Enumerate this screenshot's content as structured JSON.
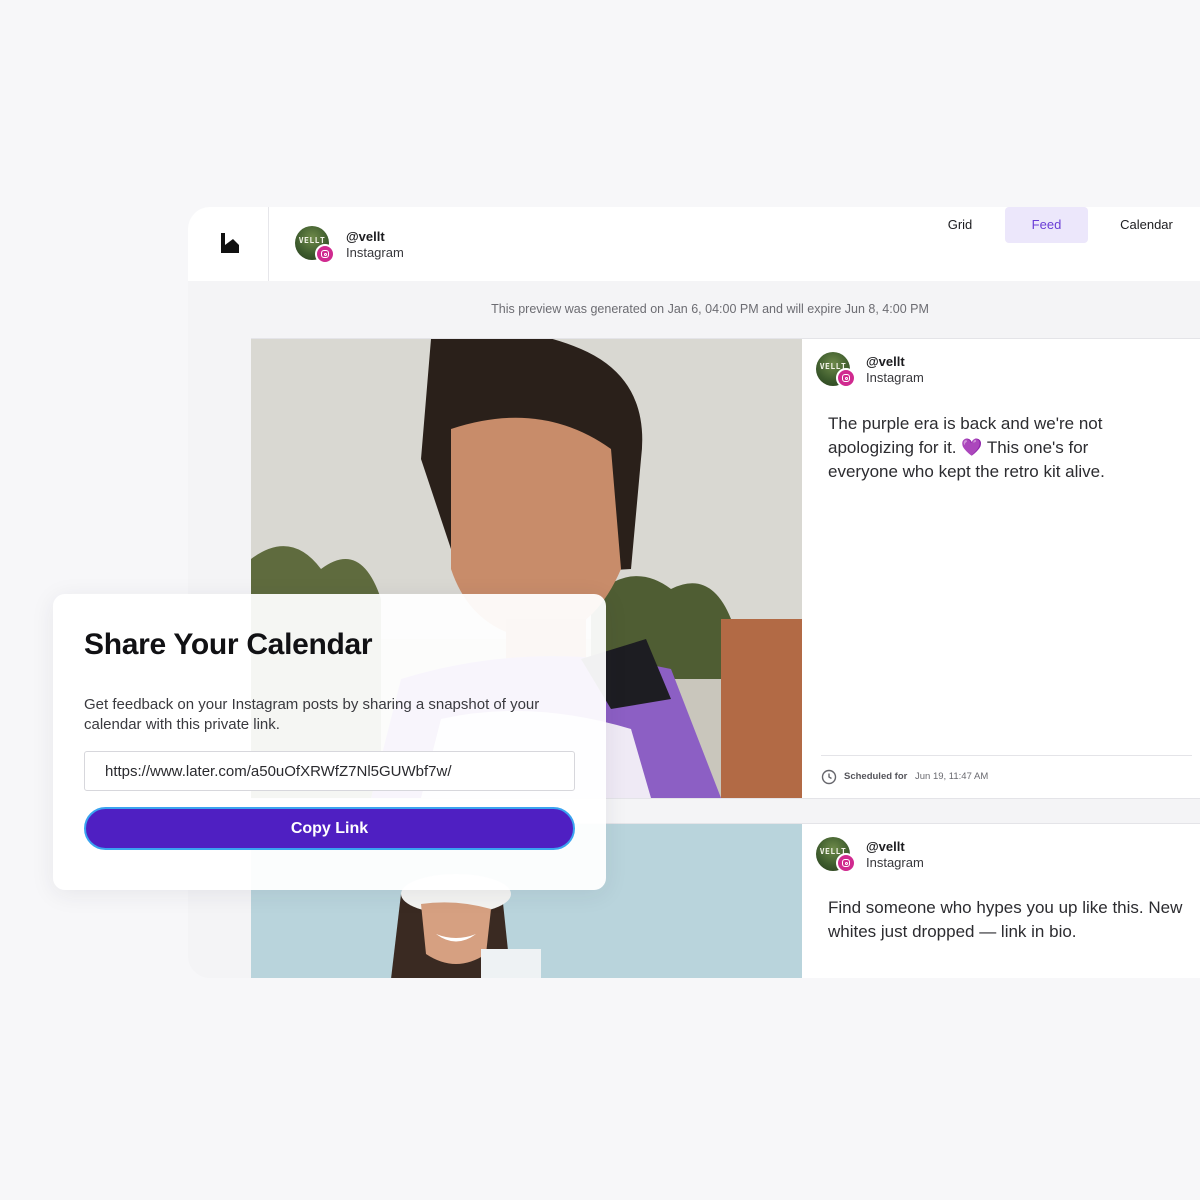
{
  "account": {
    "handle": "@vellt",
    "network": "Instagram",
    "avatar_text": "VELLT"
  },
  "tabs": [
    {
      "label": "Grid",
      "active": false
    },
    {
      "label": "Feed",
      "active": true
    },
    {
      "label": "Calendar",
      "active": false
    }
  ],
  "notice": "This preview was generated on Jan 6, 04:00 PM and will expire Jun 8, 4:00 PM",
  "posts": [
    {
      "handle": "@vellt",
      "network": "Instagram",
      "caption": "The purple era is back and we're not apologizing for it. 💜 This one's for everyone who kept the retro kit alive.",
      "scheduled_label": "Scheduled for",
      "scheduled_time": "Jun 19, 11:47 AM"
    },
    {
      "handle": "@vellt",
      "network": "Instagram",
      "caption": "Find someone who hypes you up like this. New whites just dropped — link in bio."
    }
  ],
  "share": {
    "title": "Share Your Calendar",
    "description": "Get feedback on your Instagram posts by sharing a snapshot of your calendar with this private link.",
    "link": "https://www.later.com/a50uOfXRWfZ7Nl5GUWbf7w/",
    "button": "Copy Link"
  },
  "colors": {
    "accent": "#4f1fc2",
    "active_tab_bg": "#ece7fb",
    "active_tab_text": "#6a3ed6",
    "instagram": "#d02a8f"
  }
}
